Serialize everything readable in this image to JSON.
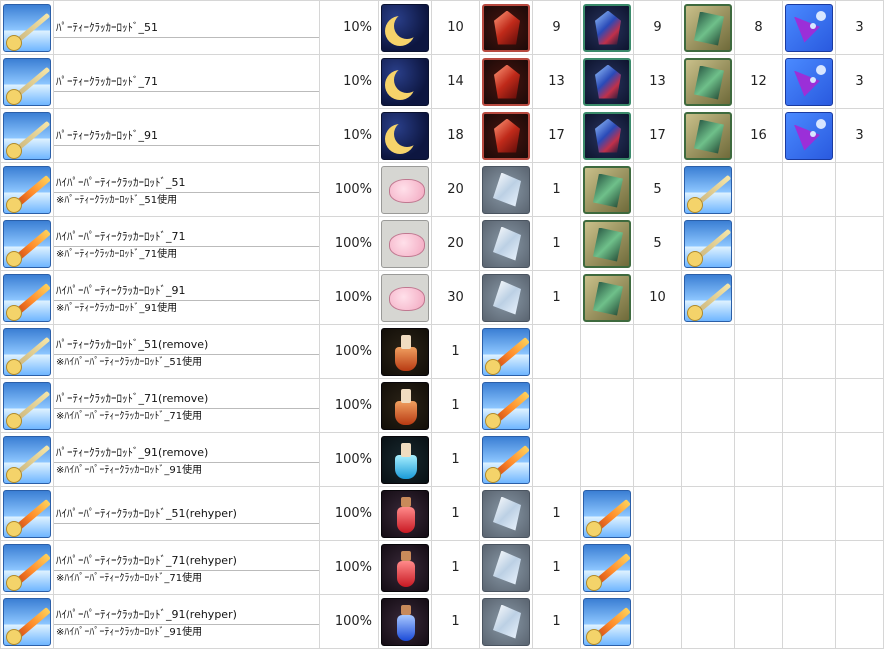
{
  "item_icons": {
    "rod": "party-cracker-rod-icon",
    "hyper_rod": "hyper-party-cracker-rod-icon",
    "moon": "crescent-moon-icon",
    "ruby": "red-crystal-icon",
    "sapphire": "blue-crystal-icon",
    "plate": "green-plate-icon",
    "potion": "purple-potion-icon",
    "meat": "pink-meat-icon",
    "ice": "ice-crystal-icon",
    "flask": "orange-flask-icon",
    "flask_blue": "blue-flask-icon",
    "vial_red": "red-vial-icon",
    "vial_blue": "blue-vial-icon"
  },
  "rows": [
    {
      "name": "ﾊﾟｰﾃｨｰｸﾗｯｶｰﾛｯﾄﾞ_51",
      "note": "",
      "rate": "10%",
      "amounts": [
        "10",
        "9",
        "9",
        "8",
        "3"
      ]
    },
    {
      "name": "ﾊﾟｰﾃｨｰｸﾗｯｶｰﾛｯﾄﾞ_71",
      "note": "",
      "rate": "10%",
      "amounts": [
        "14",
        "13",
        "13",
        "12",
        "3"
      ]
    },
    {
      "name": "ﾊﾟｰﾃｨｰｸﾗｯｶｰﾛｯﾄﾞ_91",
      "note": "",
      "rate": "10%",
      "amounts": [
        "18",
        "17",
        "17",
        "16",
        "3"
      ]
    },
    {
      "name": "ﾊｲﾊﾟｰﾊﾟｰﾃｨｰｸﾗｯｶｰﾛｯﾄﾞ_51",
      "note": "※ﾊﾟｰﾃｨｰｸﾗｯｶｰﾛｯﾄﾞ_51使用",
      "rate": "100%",
      "amounts": [
        "20",
        "1",
        "5",
        "",
        ""
      ]
    },
    {
      "name": "ﾊｲﾊﾟｰﾊﾟｰﾃｨｰｸﾗｯｶｰﾛｯﾄﾞ_71",
      "note": "※ﾊﾟｰﾃｨｰｸﾗｯｶｰﾛｯﾄﾞ_71使用",
      "rate": "100%",
      "amounts": [
        "20",
        "1",
        "5",
        "",
        ""
      ]
    },
    {
      "name": "ﾊｲﾊﾟｰﾊﾟｰﾃｨｰｸﾗｯｶｰﾛｯﾄﾞ_91",
      "note": "※ﾊﾟｰﾃｨｰｸﾗｯｶｰﾛｯﾄﾞ_91使用",
      "rate": "100%",
      "amounts": [
        "30",
        "1",
        "10",
        "",
        ""
      ]
    },
    {
      "name": "ﾊﾟｰﾃｨｰｸﾗｯｶｰﾛｯﾄﾞ_51(remove)",
      "note": "※ﾊｲﾊﾟｰﾊﾟｰﾃｨｰｸﾗｯｶｰﾛｯﾄﾞ_51使用",
      "rate": "100%",
      "amounts": [
        "1",
        "",
        "",
        "",
        ""
      ]
    },
    {
      "name": "ﾊﾟｰﾃｨｰｸﾗｯｶｰﾛｯﾄﾞ_71(remove)",
      "note": "※ﾊｲﾊﾟｰﾊﾟｰﾃｨｰｸﾗｯｶｰﾛｯﾄﾞ_71使用",
      "rate": "100%",
      "amounts": [
        "1",
        "",
        "",
        "",
        ""
      ]
    },
    {
      "name": "ﾊﾟｰﾃｨｰｸﾗｯｶｰﾛｯﾄﾞ_91(remove)",
      "note": "※ﾊｲﾊﾟｰﾊﾟｰﾃｨｰｸﾗｯｶｰﾛｯﾄﾞ_91使用",
      "rate": "100%",
      "amounts": [
        "1",
        "",
        "",
        "",
        ""
      ]
    },
    {
      "name": "ﾊｲﾊﾟｰﾊﾟｰﾃｨｰｸﾗｯｶｰﾛｯﾄﾞ_51(rehyper)",
      "note": "",
      "rate": "100%",
      "amounts": [
        "1",
        "1",
        "",
        "",
        ""
      ]
    },
    {
      "name": "ﾊｲﾊﾟｰﾊﾟｰﾃｨｰｸﾗｯｶｰﾛｯﾄﾞ_71(rehyper)",
      "note": "※ﾊｲﾊﾟｰﾊﾟｰﾃｨｰｸﾗｯｶｰﾛｯﾄﾞ_71使用",
      "rate": "100%",
      "amounts": [
        "1",
        "1",
        "",
        "",
        ""
      ]
    },
    {
      "name": "ﾊｲﾊﾟｰﾊﾟｰﾃｨｰｸﾗｯｶｰﾛｯﾄﾞ_91(rehyper)",
      "note": "※ﾊｲﾊﾟｰﾊﾟｰﾃｨｰｸﾗｯｶｰﾛｯﾄﾞ_91使用",
      "rate": "100%",
      "amounts": [
        "1",
        "1",
        "",
        "",
        ""
      ]
    }
  ]
}
